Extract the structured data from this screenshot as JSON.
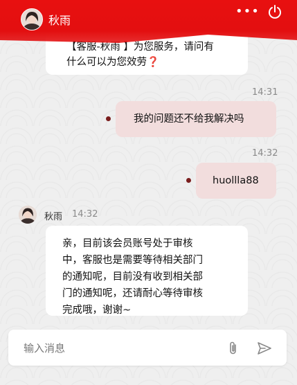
{
  "header": {
    "title": "秋雨",
    "more_icon": "more-dots-icon",
    "power_icon": "power-icon"
  },
  "messages": [
    {
      "side": "in",
      "text_line1": "【客服-秋雨 】为您服务，请问有",
      "text_line2": "什么可以为您效劳",
      "question_mark": "❓"
    },
    {
      "side": "out",
      "time": "14:31",
      "text": "我的问题还不给我解决吗"
    },
    {
      "side": "out",
      "time": "14:32",
      "text": "huollla88"
    },
    {
      "side": "in",
      "sender": "秋雨",
      "time": "14:32",
      "lines": [
        "亲，目前该会员账号处于审核",
        "中，客服也是需要等待相关部门",
        "的通知呢，目前没有收到相关部",
        "门的通知呢，还请耐心等待审核",
        "完成哦，谢谢~"
      ]
    }
  ],
  "input": {
    "placeholder": "输入消息",
    "attach_icon": "paperclip-icon",
    "send_icon": "send-icon"
  },
  "colors": {
    "header_red": "#e30f10",
    "outgoing_bubble": "#f2dddd",
    "status_dot": "#7a1d1d"
  }
}
